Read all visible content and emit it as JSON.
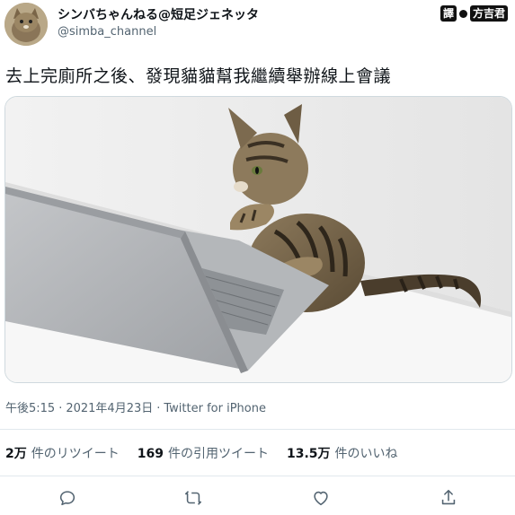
{
  "tweet": {
    "display_name": "シンバちゃんねる@短足ジェネッタ",
    "handle": "@simba_channel",
    "text": "去上完廁所之後、發現貓貓幫我繼續舉辦線上會議",
    "time": "午後5:15",
    "date": "2021年4月23日",
    "separator": "·",
    "client": "Twitter for iPhone"
  },
  "translator_badge": {
    "label_left": "譯",
    "label_right": "方吉君"
  },
  "stats": [
    {
      "num": "2万",
      "label": "件のリツイート"
    },
    {
      "num": "169",
      "label": "件の引用ツイート"
    },
    {
      "num": "13.5万",
      "label": "件のいいね"
    }
  ],
  "actions": {
    "reply_icon": "reply-icon",
    "retweet_icon": "retweet-icon",
    "like_icon": "heart-icon",
    "share_icon": "share-icon"
  },
  "colors": {
    "text_primary": "#0f1419",
    "text_secondary": "#536471",
    "divider": "#e1e8ed"
  }
}
